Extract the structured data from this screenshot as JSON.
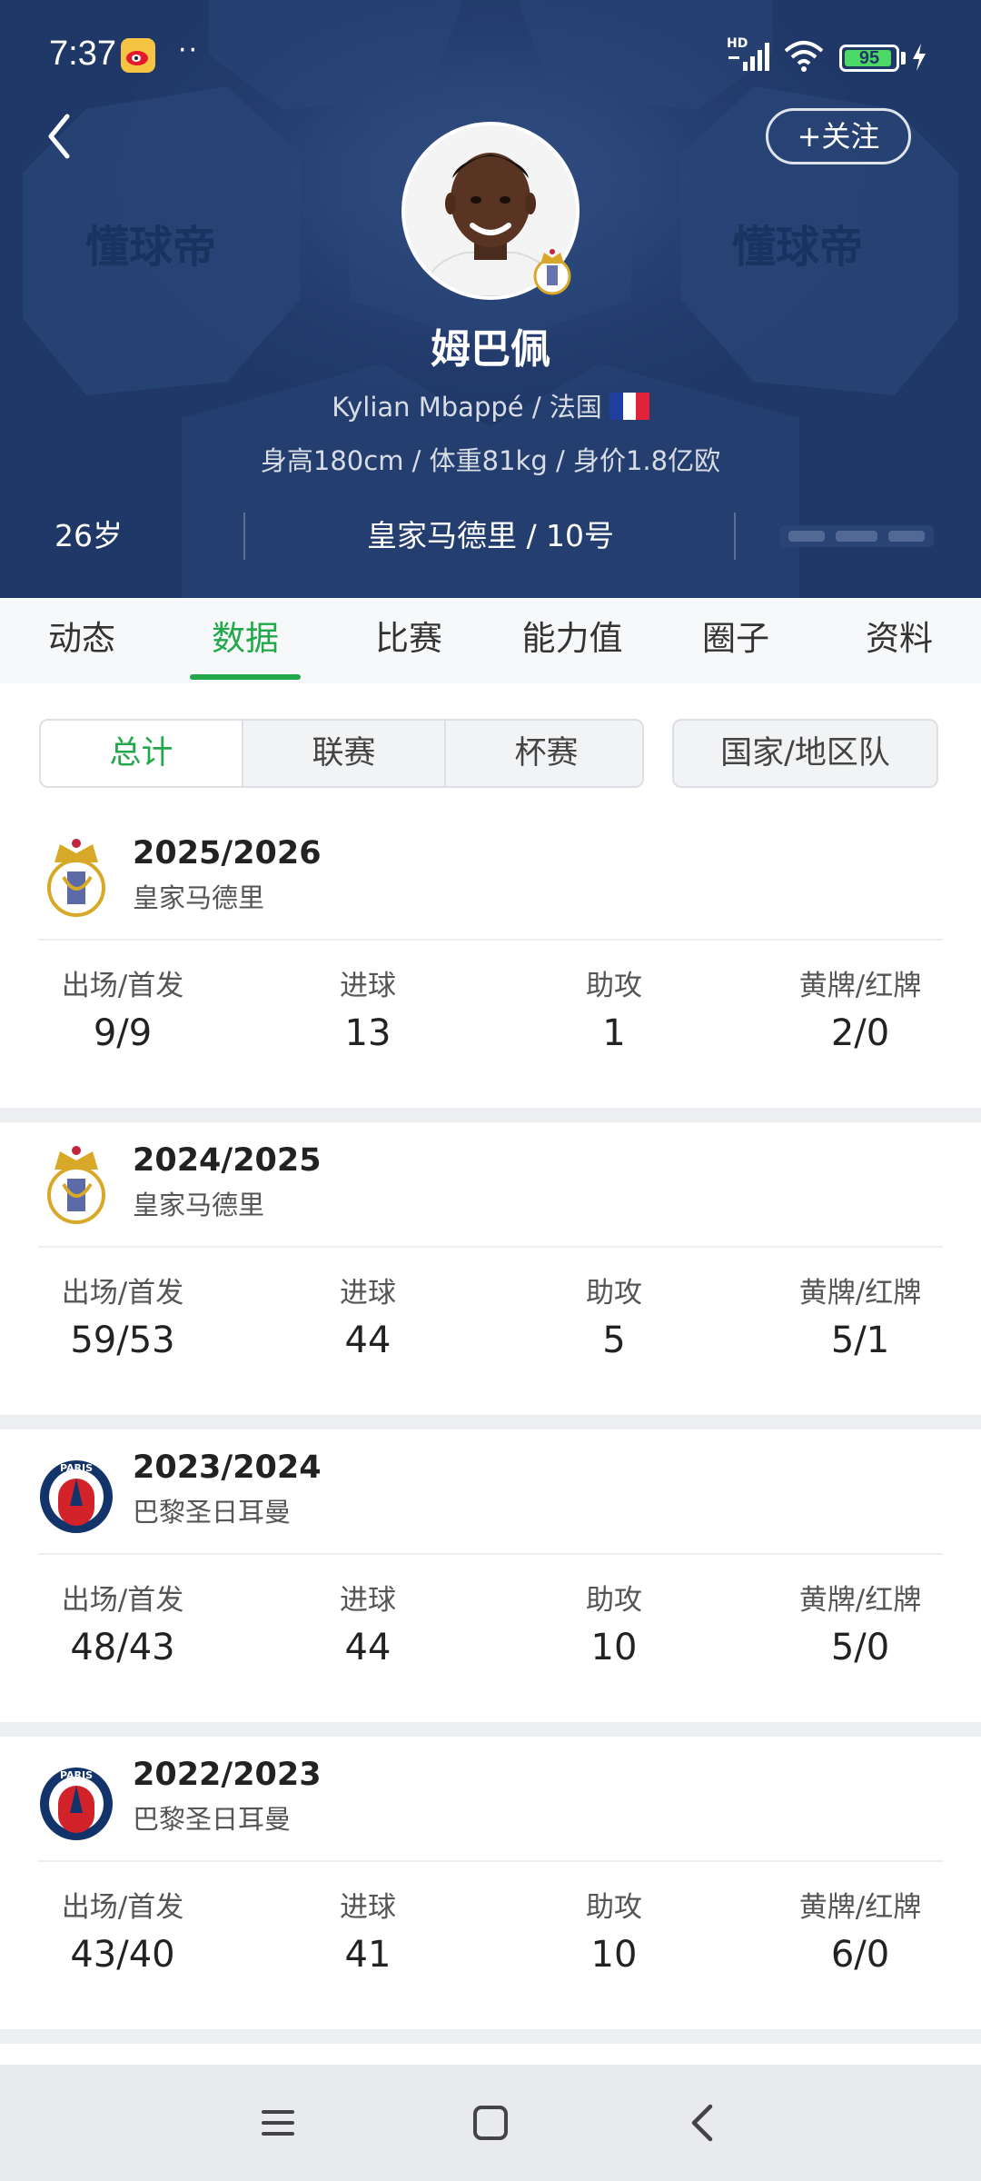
{
  "status_bar": {
    "time": "7:37",
    "dots": "··",
    "hd_label": "HD",
    "battery_level": 95,
    "battery_text": "95",
    "icons": [
      "weibo-icon",
      "signal-icon",
      "wifi-icon",
      "battery-icon",
      "charging-icon"
    ]
  },
  "header": {
    "follow_label": "+关注",
    "watermark": "懂球帝",
    "player_name": "姆巴佩",
    "english_name_nation": "Kylian Mbappé / 法国",
    "measurements": "身高180cm / 体重81kg / 身价1.8亿欧",
    "age": "26岁",
    "team_number": "皇家马德里 / 10号",
    "colors": {
      "background": "#1f3868",
      "accent": "#22a84a"
    }
  },
  "tabs": [
    {
      "label": "动态",
      "active": false
    },
    {
      "label": "数据",
      "active": true
    },
    {
      "label": "比赛",
      "active": false
    },
    {
      "label": "能力值",
      "active": false
    },
    {
      "label": "圈子",
      "active": false
    },
    {
      "label": "资料",
      "active": false
    }
  ],
  "filters": {
    "segments": [
      {
        "label": "总计",
        "active": true
      },
      {
        "label": "联赛",
        "active": false
      },
      {
        "label": "杯赛",
        "active": false
      }
    ],
    "national_label": "国家/地区队"
  },
  "stat_labels": {
    "apps": "出场/首发",
    "goals": "进球",
    "assists": "助攻",
    "cards": "黄牌/红牌"
  },
  "seasons": [
    {
      "year": "2025/2026",
      "club": "皇家马德里",
      "logo": "real-madrid-logo",
      "apps": "9/9",
      "goals": "13",
      "assists": "1",
      "cards": "2/0"
    },
    {
      "year": "2024/2025",
      "club": "皇家马德里",
      "logo": "real-madrid-logo",
      "apps": "59/53",
      "goals": "44",
      "assists": "5",
      "cards": "5/1"
    },
    {
      "year": "2023/2024",
      "club": "巴黎圣日耳曼",
      "logo": "psg-logo",
      "apps": "48/43",
      "goals": "44",
      "assists": "10",
      "cards": "5/0"
    },
    {
      "year": "2022/2023",
      "club": "巴黎圣日耳曼",
      "logo": "psg-logo",
      "apps": "43/40",
      "goals": "41",
      "assists": "10",
      "cards": "6/0"
    }
  ],
  "bottom_nav": [
    "menu-icon",
    "home-icon",
    "back-icon"
  ]
}
